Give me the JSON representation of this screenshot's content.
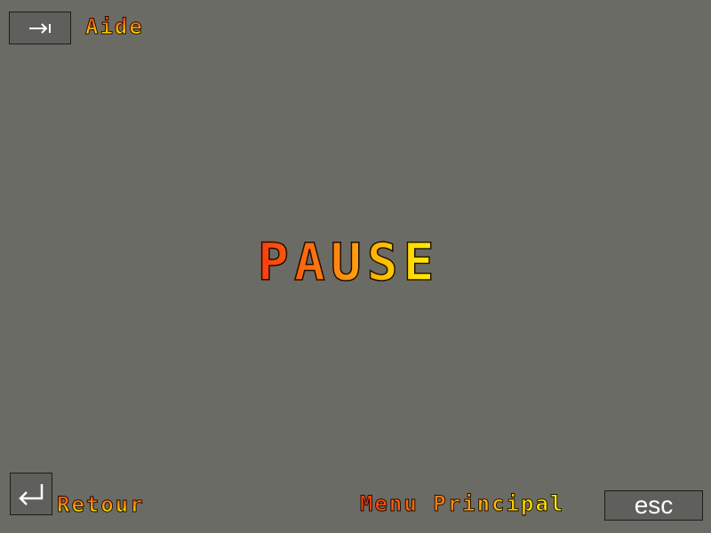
{
  "top_left": {
    "key_icon": "tab-arrow-icon",
    "label": "Aide"
  },
  "center": {
    "title": "PAUSE"
  },
  "bottom_left": {
    "key_icon": "enter-return-icon",
    "label": "Retour"
  },
  "bottom_right": {
    "label": "Menu Principal",
    "key_label": "esc"
  },
  "colors": {
    "background": "#6b6b66",
    "key_background": "#5f5f5c",
    "text_gradient_start": "#ff3a10",
    "text_gradient_end": "#fff200"
  }
}
